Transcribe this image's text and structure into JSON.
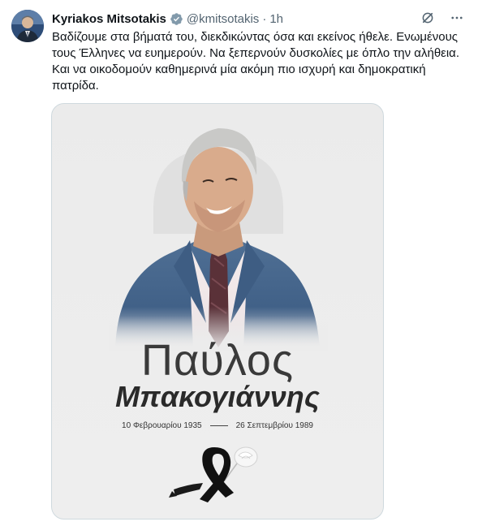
{
  "tweet": {
    "author_name": "Kyriakos Mitsotakis",
    "handle": "@kmitsotakis",
    "separator": "·",
    "time": "1h",
    "text_lines": [
      "Βαδίζουμε στα βήματά του, διεκδικώντας όσα και εκείνος ήθελε. Ενωμένους",
      "τους Έλληνες να ευημερούν. Να ξεπερνούν δυσκολίες με όπλο την αλήθεια.",
      "Και να οικοδομούν καθημερινά μία ακόμη πιο ισχυρή και δημοκρατική",
      "πατρίδα."
    ]
  },
  "media": {
    "first_name": "Παύλος",
    "surname": "Μπακογιάννης",
    "birth_date": "10 Φεβρουαρίου 1935",
    "death_date": "26 Σεπτεμβρίου 1989"
  },
  "icons": {
    "verified": "verified-badge-icon",
    "grok": "grok-icon",
    "more": "more-options-icon"
  },
  "colors": {
    "verified_blue": "#1d9bf0",
    "text_primary": "#0f1419",
    "text_secondary": "#536471"
  }
}
